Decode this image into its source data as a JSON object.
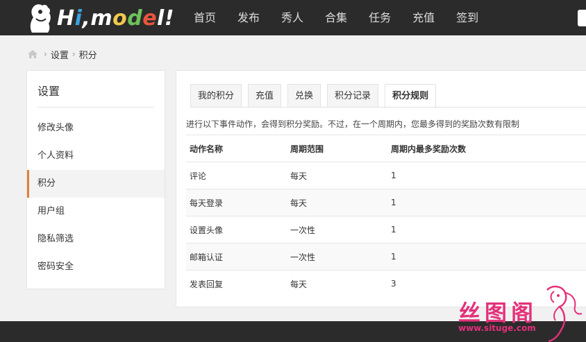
{
  "header": {
    "logo_text": [
      "H",
      "i",
      ",",
      "m",
      "o",
      "d",
      "e",
      "l",
      "!"
    ],
    "nav": [
      "首页",
      "发布",
      "秀人",
      "合集",
      "任务",
      "充值",
      "签到"
    ]
  },
  "breadcrumb": {
    "items": [
      "设置",
      "积分"
    ]
  },
  "sidebar": {
    "title": "设置",
    "items": [
      {
        "label": "修改头像"
      },
      {
        "label": "个人资料"
      },
      {
        "label": "积分",
        "active": true
      },
      {
        "label": "用户组"
      },
      {
        "label": "隐私筛选"
      },
      {
        "label": "密码安全"
      }
    ]
  },
  "tabs": [
    {
      "label": "我的积分"
    },
    {
      "label": "充值"
    },
    {
      "label": "兑换"
    },
    {
      "label": "积分记录"
    },
    {
      "label": "积分规则",
      "active": true
    }
  ],
  "description": "进行以下事件动作，会得到积分奖励。不过，在一个周期内，您最多得到的奖励次数有限制",
  "table": {
    "headers": [
      "动作名称",
      "周期范围",
      "周期内最多奖励次数"
    ],
    "rows": [
      [
        "评论",
        "每天",
        "1"
      ],
      [
        "每天登录",
        "每天",
        "1"
      ],
      [
        "设置头像",
        "一次性",
        "1"
      ],
      [
        "邮箱认证",
        "一次性",
        "1"
      ],
      [
        "发表回复",
        "每天",
        "3"
      ]
    ]
  },
  "watermark": {
    "text": "丝图阁",
    "url": "www.situge.com"
  },
  "colors": {
    "header_bg": "#2b2b2b",
    "accent": "#e17e3a",
    "watermark": "#e4307a"
  }
}
